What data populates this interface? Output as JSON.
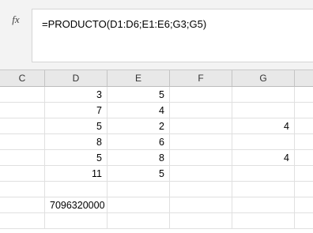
{
  "formula_bar": {
    "fx_icon": "fx",
    "formula": "=PRODUCTO(D1:D6;E1:E6;G3;G5)"
  },
  "columns": [
    "C",
    "D",
    "E",
    "F",
    "G"
  ],
  "rows": [
    {
      "C": "",
      "D": "3",
      "E": "5",
      "F": "",
      "G": ""
    },
    {
      "C": "",
      "D": "7",
      "E": "4",
      "F": "",
      "G": ""
    },
    {
      "C": "",
      "D": "5",
      "E": "2",
      "F": "",
      "G": "4"
    },
    {
      "C": "",
      "D": "8",
      "E": "6",
      "F": "",
      "G": ""
    },
    {
      "C": "",
      "D": "5",
      "E": "8",
      "F": "",
      "G": "4"
    },
    {
      "C": "",
      "D": "11",
      "E": "5",
      "F": "",
      "G": ""
    },
    {
      "C": "",
      "D": "",
      "E": "",
      "F": "",
      "G": ""
    },
    {
      "C": "",
      "D": "7096320000",
      "E": "",
      "F": "",
      "G": ""
    },
    {
      "C": "",
      "D": "",
      "E": "",
      "F": "",
      "G": ""
    }
  ]
}
